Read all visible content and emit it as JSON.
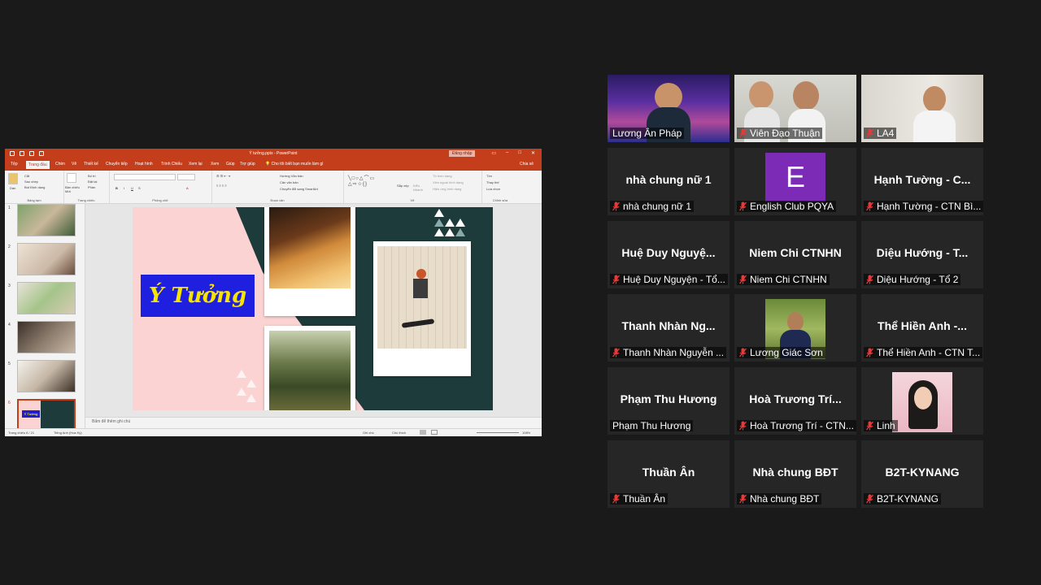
{
  "ppt": {
    "window_title": "Ý tưởng.pptx - PowerPoint",
    "signin_label": "Đăng nhập",
    "tabs": [
      "Tệp",
      "Trang đầu",
      "Chèn",
      "Vẽ",
      "Thiết kế",
      "Chuyển tiếp",
      "Hoạt hình",
      "Trình Chiếu",
      "Xem lại",
      "Xem",
      "Giúp",
      "Trợ giúp"
    ],
    "active_tab_index": 1,
    "tell_me": "Cho tôi biết bạn muốn làm gì",
    "share_label": "Chia sẻ",
    "ribbon": {
      "paste": "Dán",
      "cut": "Cắt",
      "copy": "Sao chép",
      "format_painter": "Bút Định dạng",
      "clipboard_group": "Bảng tạm",
      "new_slide": "Bản chiếu Mới",
      "layout": "Bố trí",
      "reset": "Đặt lại",
      "section": "Phần",
      "slides_group": "Trang chiếu",
      "font_group": "Phông chữ",
      "text_direction": "Hướng Văn bản",
      "align_text": "Căn văn bản",
      "smartart": "Chuyển đổi sang SmartArt",
      "paragraph_group": "Đoạn văn",
      "arrange": "Sắp xếp",
      "quick_styles": "Kiểu Nhanh",
      "shape_fill": "Tô hình dạng",
      "shape_outline": "Viền ngoài hình dạng",
      "shape_effects": "Hiệu ứng hình dạng",
      "drawing_group": "Vẽ",
      "find": "Tìm",
      "replace": "Thay thế",
      "select": "Lựa chọn",
      "editing_group": "Chỉnh sửa"
    },
    "thumbnails": [
      "1",
      "2",
      "3",
      "4",
      "5",
      "6"
    ],
    "active_slide": 6,
    "slide_title": "Ý Tưởng",
    "notes_placeholder": "Bấm để thêm ghi chú",
    "status_slide": "Trang chiếu 6 / 21",
    "status_lang": "Tiếng Anh (Hoa Kỳ)",
    "status_notes": "Ghi chú",
    "status_comments": "Chú thích",
    "status_zoom": "108%"
  },
  "gallery": {
    "accent_speaking": "#f0e34a",
    "tiles": [
      {
        "id": "t1",
        "display": "video",
        "nameplate": "Lương Ân Pháp",
        "muted": false,
        "speaking": true
      },
      {
        "id": "t2",
        "display": "video",
        "nameplate": "Viên Đạo Thuận",
        "muted": true
      },
      {
        "id": "t3",
        "display": "video",
        "nameplate": "LA4",
        "muted": true
      },
      {
        "id": "t4",
        "display": "name",
        "center": "nhà chung nữ 1",
        "nameplate": "nhà chung nữ 1",
        "muted": true
      },
      {
        "id": "t5",
        "display": "avatar-letter",
        "letter": "E",
        "avatar_color": "#7b2bb5",
        "nameplate": "English Club PQYA",
        "muted": true
      },
      {
        "id": "t6",
        "display": "name",
        "center": "Hạnh Tường - C...",
        "nameplate": "Hạnh Tường - CTN Bì...",
        "muted": true
      },
      {
        "id": "t7",
        "display": "name",
        "center": "Huệ Duy Nguyệ...",
        "nameplate": "Huệ Duy Nguyện - Tổ...",
        "muted": true
      },
      {
        "id": "t8",
        "display": "name",
        "center": "Niem Chi CTNHN",
        "nameplate": "Niem Chi CTNHN",
        "muted": true
      },
      {
        "id": "t9",
        "display": "name",
        "center": "Diệu Hướng - T...",
        "nameplate": "Diệu Hướng - Tổ 2",
        "muted": true
      },
      {
        "id": "t10",
        "display": "name",
        "center": "Thanh Nhàn Ng...",
        "nameplate": "Thanh Nhàn Nguyễn ...",
        "muted": true
      },
      {
        "id": "t11",
        "display": "photo",
        "nameplate": "Lương Giác Sơn",
        "muted": true
      },
      {
        "id": "t12",
        "display": "name",
        "center": "Thể Hiền Anh -...",
        "nameplate": "Thể Hiền Anh - CTN T...",
        "muted": true
      },
      {
        "id": "t13",
        "display": "name",
        "center": "Phạm Thu Hương",
        "nameplate": "Phạm Thu Hương",
        "muted": false
      },
      {
        "id": "t14",
        "display": "name",
        "center": "Hoà Trương Trí...",
        "nameplate": "Hoà Trương Trí - CTN...",
        "muted": true
      },
      {
        "id": "t15",
        "display": "photo",
        "nameplate": "Linh",
        "muted": true
      },
      {
        "id": "t16",
        "display": "name",
        "center": "Thuần Ân",
        "nameplate": "Thuần Ân",
        "muted": true
      },
      {
        "id": "t17",
        "display": "name",
        "center": "Nhà chung BĐT",
        "nameplate": "Nhà chung BĐT",
        "muted": true
      },
      {
        "id": "t18",
        "display": "name",
        "center": "B2T-KYNANG",
        "nameplate": "B2T-KYNANG",
        "muted": true
      }
    ]
  }
}
